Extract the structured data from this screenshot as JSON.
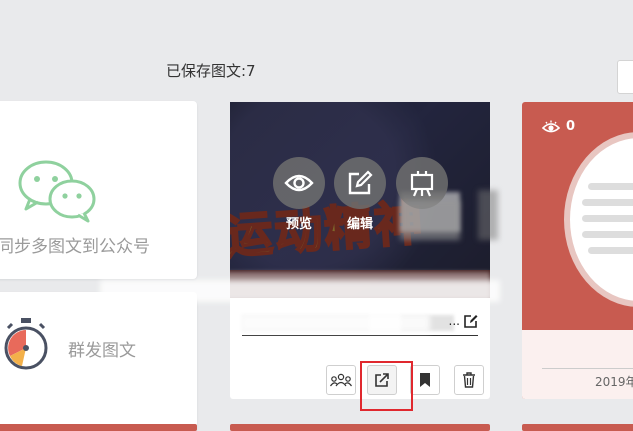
{
  "header": {
    "saved_count_label": "已保存图文:7"
  },
  "left_panel": {
    "sync_label": "同步多图文到公众号",
    "group_label": "群发图文"
  },
  "article": {
    "actions": [
      {
        "label": "预览",
        "icon": "eye-icon"
      },
      {
        "label": "编辑",
        "icon": "edit-icon"
      },
      {
        "label": "",
        "icon": "presentation-icon"
      }
    ],
    "title_ellipsis": "...",
    "toolbar": [
      "group-send-icon",
      "share-icon",
      "bookmark-icon",
      "trash-icon"
    ]
  },
  "right_article": {
    "views": "0",
    "date": "2019年"
  },
  "colors": {
    "card_red": "#c85b50",
    "highlight": "#e0282e",
    "wechat_green": "#8fd19e"
  }
}
